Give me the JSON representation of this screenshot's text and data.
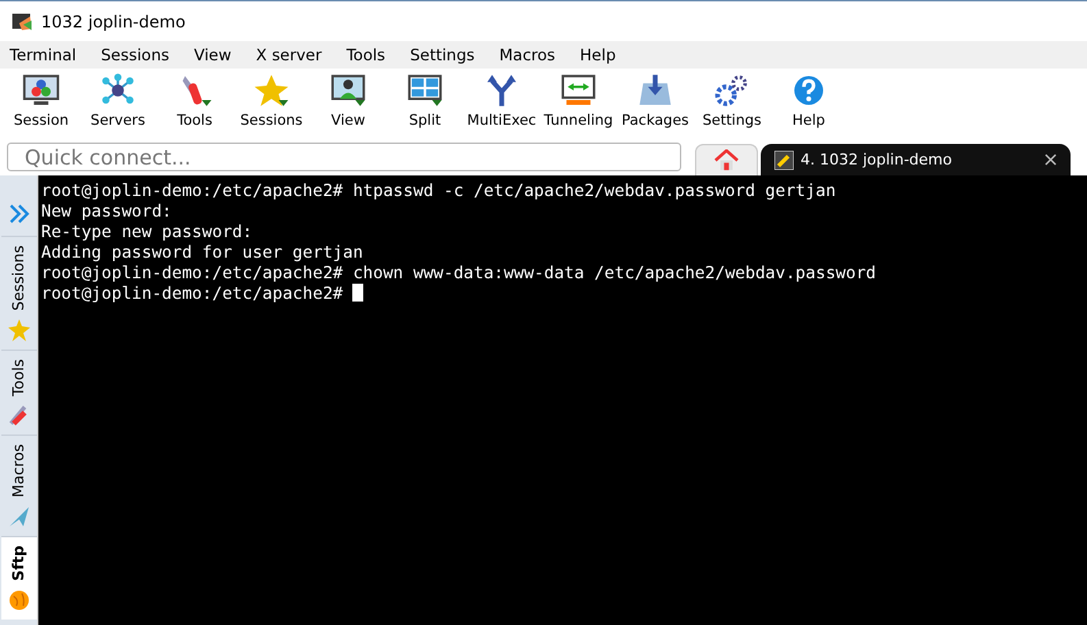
{
  "window": {
    "title": "1032 joplin-demo"
  },
  "menu": [
    "Terminal",
    "Sessions",
    "View",
    "X server",
    "Tools",
    "Settings",
    "Macros",
    "Help"
  ],
  "toolbar": [
    {
      "label": "Session",
      "kind": "session"
    },
    {
      "label": "Servers",
      "kind": "servers"
    },
    {
      "label": "Tools",
      "kind": "tools"
    },
    {
      "label": "Sessions",
      "kind": "star"
    },
    {
      "label": "View",
      "kind": "view"
    },
    {
      "label": "Split",
      "kind": "split"
    },
    {
      "label": "MultiExec",
      "kind": "fork"
    },
    {
      "label": "Tunneling",
      "kind": "tunnel"
    },
    {
      "label": "Packages",
      "kind": "packages"
    },
    {
      "label": "Settings",
      "kind": "gears"
    },
    {
      "label": "Help",
      "kind": "help"
    }
  ],
  "quick_connect": {
    "placeholder": "Quick connect..."
  },
  "tabs": [
    {
      "kind": "home",
      "selected": false
    },
    {
      "kind": "session",
      "label": "4. 1032 joplin-demo",
      "selected": true
    }
  ],
  "sidebar": [
    {
      "label": "Sessions",
      "kind": "star",
      "selected": false
    },
    {
      "label": "Tools",
      "kind": "tools",
      "selected": false
    },
    {
      "label": "Macros",
      "kind": "plane",
      "selected": false
    },
    {
      "label": "Sftp",
      "kind": "globe",
      "selected": true
    }
  ],
  "terminal": {
    "lines": [
      "root@joplin-demo:/etc/apache2# htpasswd -c /etc/apache2/webdav.password gertjan",
      "New password:",
      "Re-type new password:",
      "Adding password for user gertjan",
      "root@joplin-demo:/etc/apache2# chown www-data:www-data /etc/apache2/webdav.password",
      "root@joplin-demo:/etc/apache2# "
    ],
    "cursor": true
  }
}
